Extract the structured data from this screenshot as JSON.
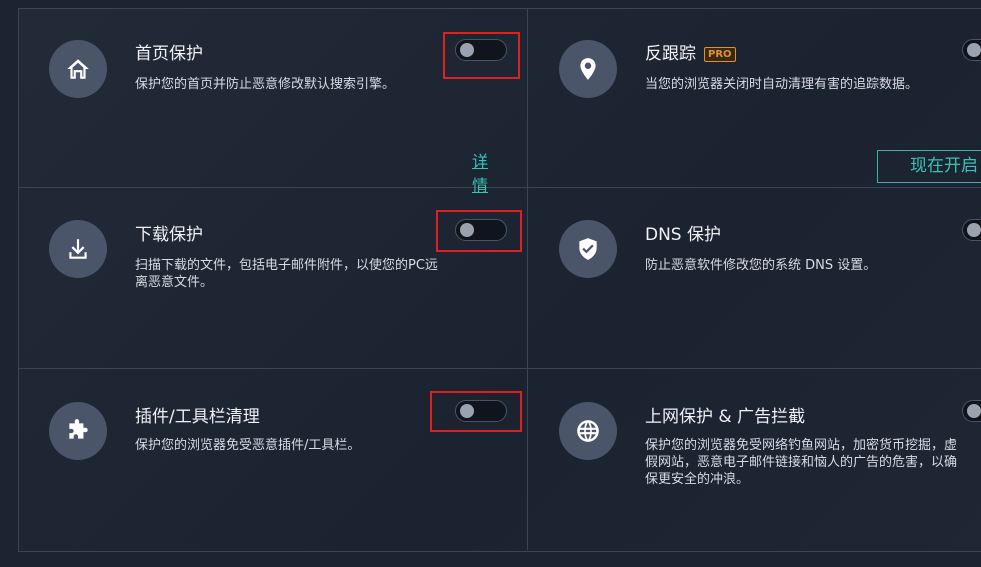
{
  "cards": {
    "home": {
      "icon": "home-icon",
      "title": "首页保护",
      "desc": "保护您的首页并防止恶意修改默认搜索引擎。",
      "toggle_on": false,
      "link": "详情"
    },
    "anti_tracking": {
      "icon": "location-pin-icon",
      "title": "反跟踪",
      "badge": "PRO",
      "desc": "当您的浏览器关闭时自动清理有害的追踪数据。",
      "toggle_on": false,
      "button": "现在开启"
    },
    "download": {
      "icon": "download-icon",
      "title": "下载保护",
      "desc": "扫描下载的文件，包括电子邮件附件，以使您的PC远离恶意文件。",
      "toggle_on": false
    },
    "dns": {
      "icon": "shield-check-icon",
      "title": "DNS 保护",
      "desc": "防止恶意软件修改您的系统 DNS 设置。",
      "toggle_on": false
    },
    "plugin": {
      "icon": "puzzle-icon",
      "title": "插件/工具栏清理",
      "desc": "保护您的浏览器免受恶意插件/工具栏。",
      "toggle_on": false
    },
    "web": {
      "icon": "globe-icon",
      "title": "上网保护 & 广告拦截",
      "desc": "保护您的浏览器免受网络钓鱼网站，加密货币挖掘，虚假网站，恶意电子邮件链接和恼人的广告的危害，以确保更安全的冲浪。",
      "toggle_on": false
    }
  },
  "colors": {
    "background": "#1d2431",
    "accent": "#35c5b8",
    "highlight": "#e02020",
    "pro": "#e0912c"
  }
}
